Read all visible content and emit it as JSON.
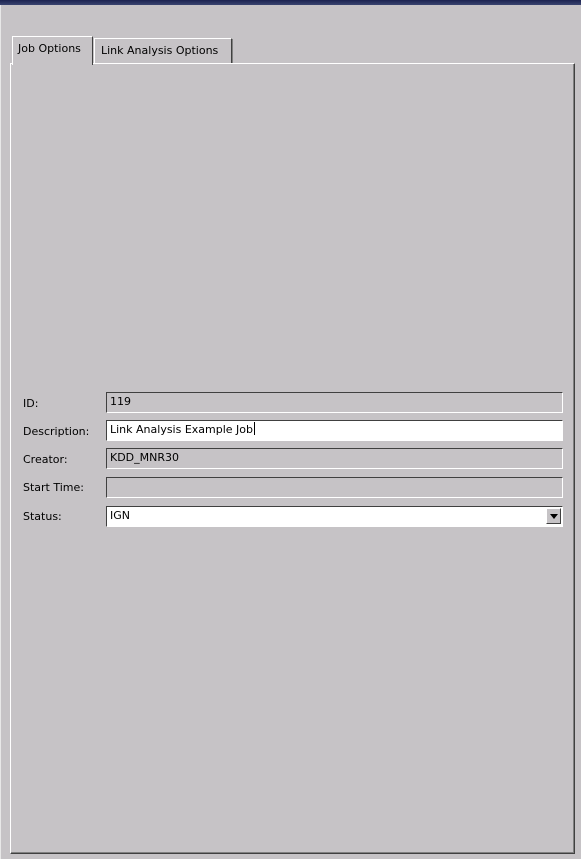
{
  "tabs": [
    {
      "label": "Job Options",
      "selected": true
    },
    {
      "label": "Link Analysis Options",
      "selected": false
    }
  ],
  "form": {
    "id": {
      "label": "ID:",
      "value": "119"
    },
    "description": {
      "label": "Description:",
      "value": "Link Analysis Example Job"
    },
    "creator": {
      "label": "Creator:",
      "value": "KDD_MNR30"
    },
    "start_time": {
      "label": "Start Time:",
      "value": ""
    },
    "status": {
      "label": "Status:",
      "value": "IGN",
      "icon": "chevron-down-icon"
    }
  },
  "colors": {
    "background": "#c6c3c6",
    "field_editable": "#ffffff",
    "top_border": "#1c2350"
  }
}
